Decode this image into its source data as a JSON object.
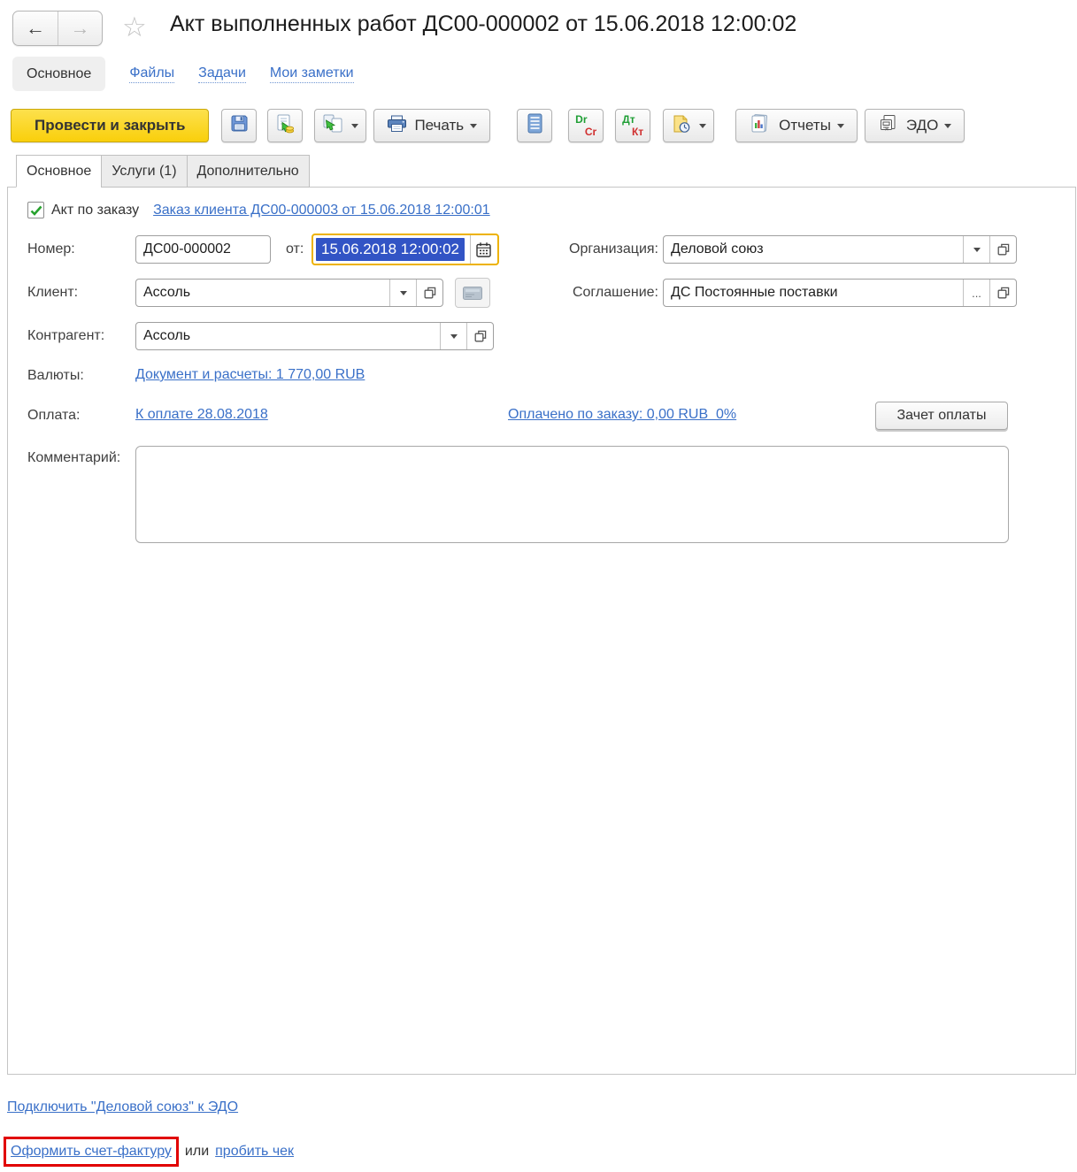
{
  "window": {
    "title": "Акт выполненных работ ДС00-000002 от 15.06.2018 12:00:02"
  },
  "nav": {
    "items": [
      {
        "label": "Основное"
      },
      {
        "label": "Файлы"
      },
      {
        "label": "Задачи"
      },
      {
        "label": "Мои заметки"
      }
    ]
  },
  "toolbar": {
    "post_close_label": "Провести и закрыть",
    "print_label": "Печать",
    "reports_label": "Отчеты",
    "edo_label": "ЭДО",
    "drcr": {
      "top": "Dr",
      "bottom": "Cr"
    },
    "dtkt": {
      "top": "Дт",
      "bottom": "Кт"
    }
  },
  "tabs": [
    {
      "label": "Основное"
    },
    {
      "label": "Услуги (1)"
    },
    {
      "label": "Дополнительно"
    }
  ],
  "form": {
    "order_checkbox_label": "Акт по заказу",
    "order_link": "Заказ клиента ДС00-000003 от 15.06.2018 12:00:01",
    "number_label": "Номер:",
    "number_value": "ДС00-000002",
    "date_label": "от:",
    "date_value": "15.06.2018 12:00:02",
    "organization_label": "Организация:",
    "organization_value": "Деловой союз",
    "client_label": "Клиент:",
    "client_value": "Ассоль",
    "agreement_label": "Соглашение:",
    "agreement_value": "ДС Постоянные поставки",
    "agreement_more": "...",
    "counterparty_label": "Контрагент:",
    "counterparty_value": "Ассоль",
    "currencies_label": "Валюты:",
    "currencies_link": "Документ и расчеты: 1 770,00 RUB",
    "payment_label": "Оплата:",
    "payment_due_link": "К оплате 28.08.2018",
    "payment_paid_link": "Оплачено по заказу: 0,00 RUB  0%",
    "payment_offset_button": "Зачет оплаты",
    "comment_label": "Комментарий:"
  },
  "footer": {
    "edo_connect_link": "Подключить \"Деловой союз\" к ЭДО",
    "invoice_link": "Оформить счет-фактуру",
    "or_text": "или",
    "receipt_link": "пробить чек"
  },
  "colors": {
    "link": "#3a70c8",
    "primary_button": "#f9cf0b",
    "focus_border": "#edb200",
    "selection": "#3254c5",
    "annotation_red": "#e10000",
    "check_green": "#27a22e"
  }
}
